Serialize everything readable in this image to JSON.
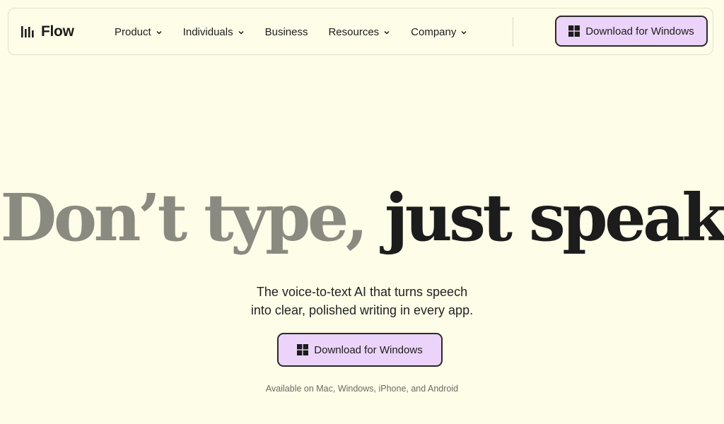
{
  "brand": {
    "name": "Flow",
    "icon": "sound-bars-icon"
  },
  "nav": {
    "items": [
      {
        "label": "Product",
        "has_dropdown": true
      },
      {
        "label": "Individuals",
        "has_dropdown": true
      },
      {
        "label": "Business",
        "has_dropdown": false
      },
      {
        "label": "Resources",
        "has_dropdown": true
      },
      {
        "label": "Company",
        "has_dropdown": true
      }
    ],
    "cta_label": "Download for Windows",
    "cta_icon": "windows-logo-icon"
  },
  "hero": {
    "title_muted": "Don’t type,",
    "title_strong": "just speak",
    "subtitle_line1": "The voice-to-text AI that turns speech",
    "subtitle_line2": "into clear, polished writing in every app.",
    "cta_label": "Download for Windows",
    "availability": "Available on Mac, Windows, iPhone, and Android"
  },
  "colors": {
    "background": "#fefde8",
    "button_fill": "#ecd3f9",
    "button_border": "#2a2a2a",
    "title_muted": "#8b8a80",
    "text": "#1c1c1c"
  }
}
